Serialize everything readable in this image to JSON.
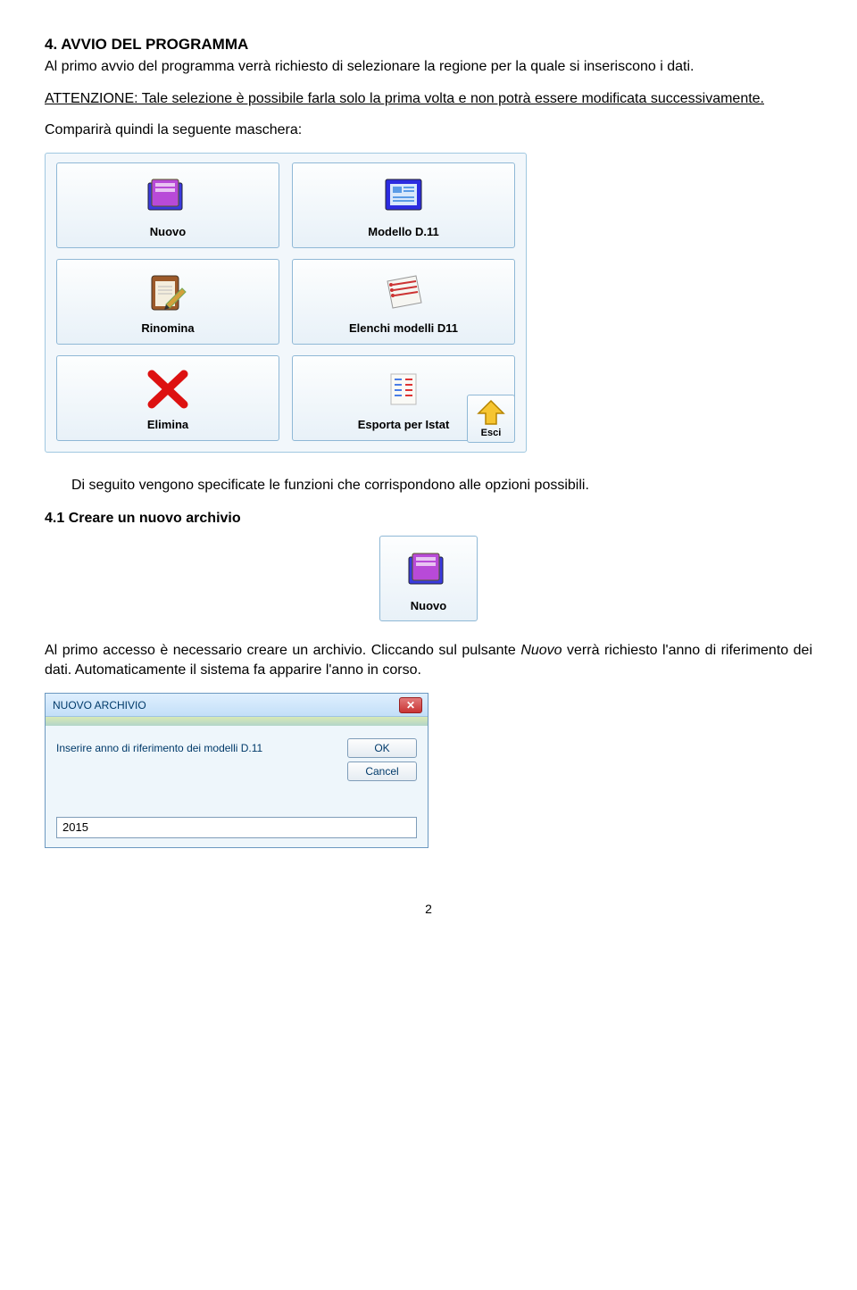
{
  "heading": "4.   AVVIO DEL PROGRAMMA",
  "p1": "Al primo avvio del programma verrà richiesto di selezionare la regione per la quale si inseriscono i dati.",
  "p2": "ATTENZIONE: Tale selezione è possibile farla solo la prima volta e non potrà essere modificata successivamente.",
  "p3": "Comparirà quindi la seguente maschera:",
  "menu": {
    "col1": [
      {
        "label": "Nuovo",
        "icon": "folder-new"
      },
      {
        "label": "Rinomina",
        "icon": "clipboard-pen"
      },
      {
        "label": "Elimina",
        "icon": "red-x"
      }
    ],
    "col2": [
      {
        "label": "Modello D.11",
        "icon": "form-screen"
      },
      {
        "label": "Elenchi modelli D11",
        "icon": "list-paper"
      },
      {
        "label": "Esporta per Istat",
        "icon": "export-lines"
      }
    ],
    "esci": {
      "label": "Esci",
      "icon": "arrow-up-yellow"
    }
  },
  "p4": "Di seguito vengono specificate le funzioni che corrispondono alle opzioni possibili.",
  "sub_heading": "4.1   Creare un nuovo archivio",
  "single_tile": {
    "label": "Nuovo",
    "icon": "folder-new"
  },
  "p5a": "Al primo accesso è necessario creare un archivio. Cliccando sul pulsante ",
  "p5b": "Nuovo",
  "p5c": " verrà richiesto l'anno di riferimento dei dati. Automaticamente il sistema fa apparire l'anno in corso.",
  "dialog": {
    "title": "NUOVO ARCHIVIO",
    "message": "Inserire anno di riferimento dei modelli D.11",
    "ok": "OK",
    "cancel": "Cancel",
    "value": "2015"
  },
  "page_number": "2"
}
